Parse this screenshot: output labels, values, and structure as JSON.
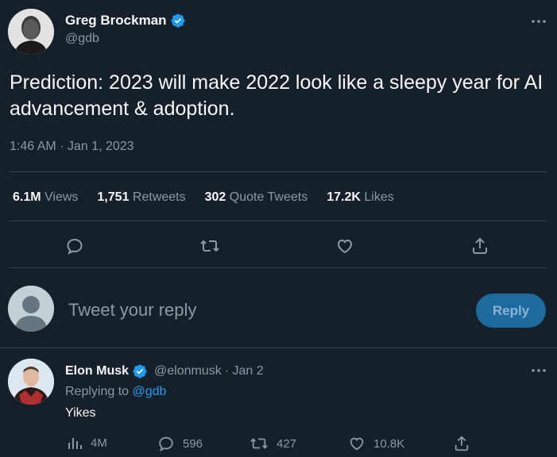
{
  "tweet": {
    "author_name": "Greg Brockman",
    "author_handle": "@gdb",
    "text": "Prediction: 2023 will make 2022 look like a sleepy year for AI advancement & adoption.",
    "timestamp": "1:46 AM · Jan 1, 2023",
    "stats": {
      "views_count": "6.1M",
      "views_label": "Views",
      "retweets_count": "1,751",
      "retweets_label": "Retweets",
      "quotes_count": "302",
      "quotes_label": "Quote Tweets",
      "likes_count": "17.2K",
      "likes_label": "Likes"
    },
    "actions": [
      "reply-icon",
      "retweet-icon",
      "like-icon",
      "share-icon"
    ]
  },
  "reply_box": {
    "placeholder": "Tweet your reply",
    "button_label": "Reply"
  },
  "reply": {
    "author_name": "Elon Musk",
    "author_handle": "@elonmusk",
    "date": "· Jan 2",
    "replying_prefix": "Replying to",
    "replying_to": "@gdb",
    "text": "Yikes",
    "views": "4M",
    "replies": "596",
    "retweets": "427",
    "likes": "10.8K"
  },
  "colors": {
    "background": "#15202b",
    "text_primary": "#f7f9f9",
    "text_secondary": "#8b98a5",
    "accent": "#1d9bf0",
    "divider": "#38444d",
    "reply_button_bg": "#1d6a9e"
  }
}
